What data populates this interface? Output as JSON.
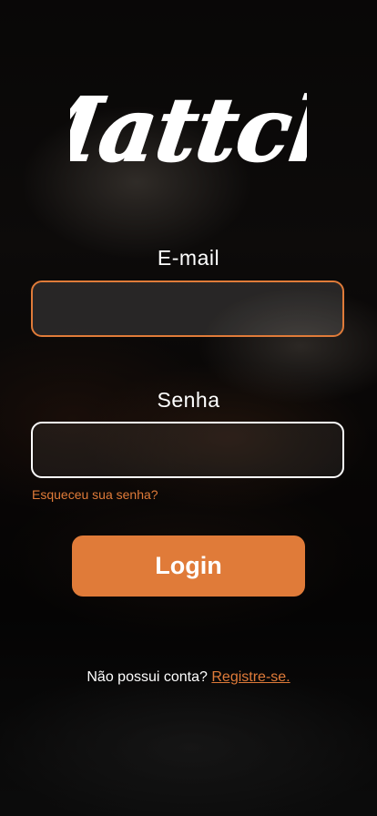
{
  "brand": {
    "logo_text": "Mattch",
    "accent_color": "#e07b39"
  },
  "form": {
    "email_label": "E-mail",
    "email_value": "",
    "email_placeholder": "",
    "password_label": "Senha",
    "password_value": "",
    "password_placeholder": "",
    "forgot_label": "Esqueceu sua senha?",
    "login_label": "Login"
  },
  "footer": {
    "prompt": "Não possui conta?",
    "register_label": "Registre-se."
  }
}
